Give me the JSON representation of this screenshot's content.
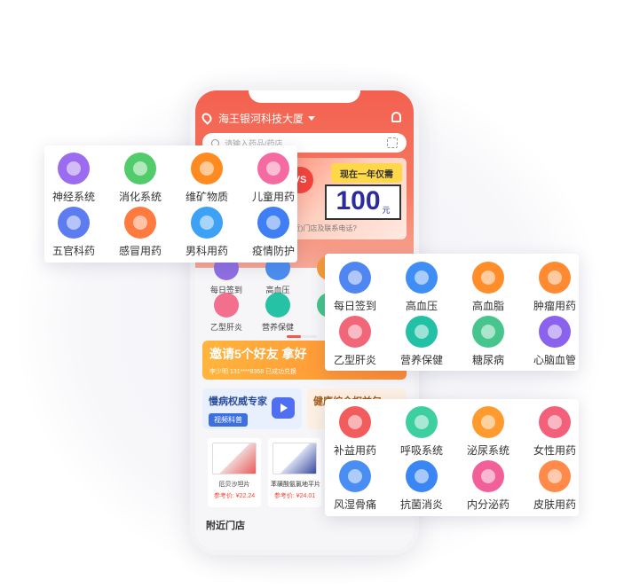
{
  "phone": {
    "location": "海王银河科技大厦",
    "search_placeholder": "请输入药品/药店",
    "banner": {
      "tag": "现在一年仅需",
      "price": "100",
      "unit": "元",
      "vs": "VS",
      "caption": "(附近)门店及联系电话?"
    },
    "grid": [
      {
        "label": "每日签到",
        "color": "#8f6fe3"
      },
      {
        "label": "高血压",
        "color": "#4b8ef0"
      },
      {
        "label": "高",
        "color": "#f59a3a"
      },
      {
        "label": "乙型肝炎",
        "color": "#f26f8e"
      },
      {
        "label": "营养保健",
        "color": "#25c2a6"
      },
      {
        "label": "糖",
        "color": "#44c38a"
      }
    ],
    "invite": {
      "title": "邀请5个好友 拿好",
      "sub": "李少明 131****8368 已成功兑换"
    },
    "card_chronic": {
      "title": "慢病权威专家",
      "pill": "视频科普"
    },
    "card_health": {
      "title": "健康综合权益包"
    },
    "products": [
      {
        "name": "厄贝沙坦片",
        "price": "参考价: ¥22.24"
      },
      {
        "name": "苯磺酸氨氯地平片",
        "price": "参考价: ¥24.01"
      }
    ],
    "nearby": "附近门店"
  },
  "card_top": [
    {
      "label": "神经系统",
      "icon": "brain-icon",
      "color": "#9b6cf0"
    },
    {
      "label": "消化系统",
      "icon": "stomach-icon",
      "color": "#52cc6b"
    },
    {
      "label": "维矿物质",
      "icon": "carrot-icon",
      "color": "#ff8a1f"
    },
    {
      "label": "儿童用药",
      "icon": "child-icon",
      "color": "#f56aa0"
    },
    {
      "label": "五官科药",
      "icon": "face-icon",
      "color": "#5d7cf0"
    },
    {
      "label": "感冒用药",
      "icon": "thermometer-icon",
      "color": "#ff7a3e"
    },
    {
      "label": "男科用药",
      "icon": "male-icon",
      "color": "#3da1f5"
    },
    {
      "label": "疫情防护",
      "icon": "shield-icon",
      "color": "#3f7ef3"
    }
  ],
  "card_mid": [
    {
      "label": "每日签到",
      "icon": "calendar-icon",
      "color": "#4f86f2"
    },
    {
      "label": "高血压",
      "icon": "monitor-icon",
      "color": "#3f8ef5"
    },
    {
      "label": "高血脂",
      "icon": "molecule-icon",
      "color": "#ff8d2a"
    },
    {
      "label": "肿瘤用药",
      "icon": "cell-icon",
      "color": "#ff8a32"
    },
    {
      "label": "乙型肝炎",
      "icon": "liver-icon",
      "color": "#f2667a"
    },
    {
      "label": "营养保健",
      "icon": "bottle-icon",
      "color": "#22c0a4"
    },
    {
      "label": "糖尿病",
      "icon": "house-icon",
      "color": "#46c58c"
    },
    {
      "label": "心脑血管",
      "icon": "heart-icon",
      "color": "#8a62ee"
    }
  ],
  "card_bot": [
    {
      "label": "补益用药",
      "icon": "flame-icon",
      "color": "#f25c5c"
    },
    {
      "label": "呼吸系统",
      "icon": "lungs-icon",
      "color": "#3ecfa0"
    },
    {
      "label": "泌尿系统",
      "icon": "kidney-icon",
      "color": "#ff9a2e"
    },
    {
      "label": "女性用药",
      "icon": "female-icon",
      "color": "#f2607a"
    },
    {
      "label": "风湿骨痛",
      "icon": "bone-icon",
      "color": "#4a8ef3"
    },
    {
      "label": "抗菌消炎",
      "icon": "shield-plus-icon",
      "color": "#3a86f5"
    },
    {
      "label": "内分泌药",
      "icon": "thyroid-icon",
      "color": "#f2609a"
    },
    {
      "label": "皮肤用药",
      "icon": "skin-icon",
      "color": "#ff8a4a"
    }
  ]
}
